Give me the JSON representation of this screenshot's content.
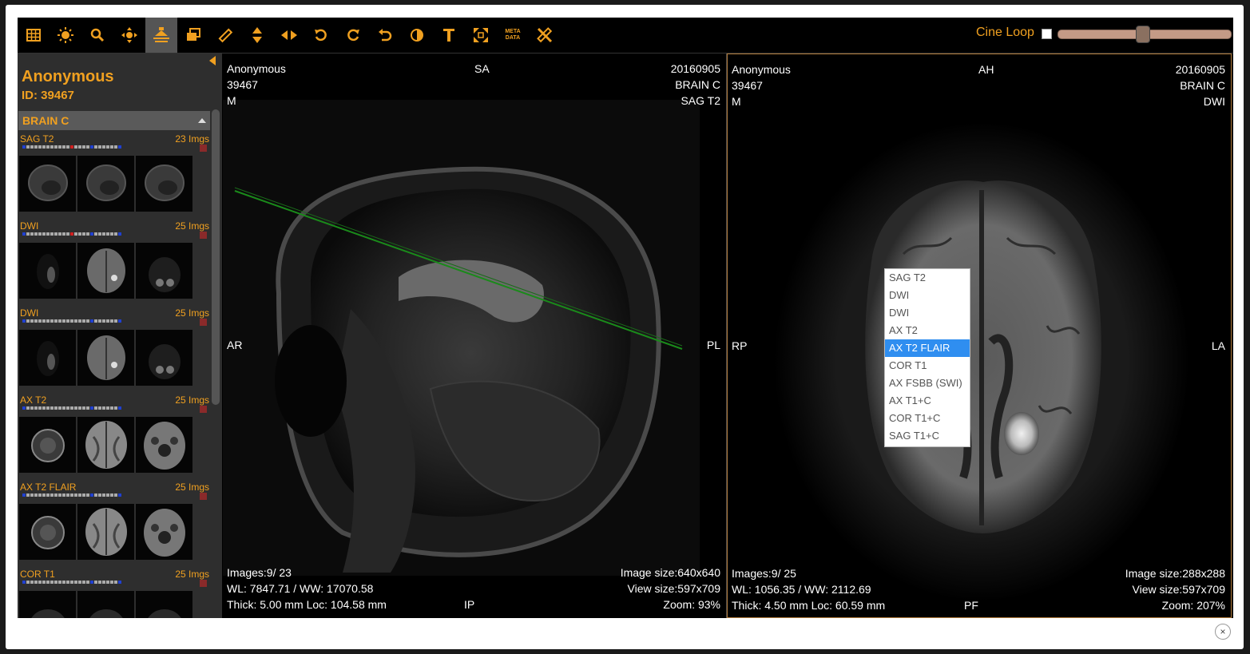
{
  "toolbar": {
    "cine_label": "Cine Loop",
    "meta_line1": "META",
    "meta_line2": "DATA",
    "accent": "#f0a020"
  },
  "patient": {
    "name": "Anonymous",
    "id": "ID: 39467"
  },
  "study": {
    "title": "BRAIN C"
  },
  "series": [
    {
      "name": "SAG T2",
      "count": "23 Imgs"
    },
    {
      "name": "DWI",
      "count": "25 Imgs"
    },
    {
      "name": "DWI",
      "count": "25 Imgs"
    },
    {
      "name": "AX T2",
      "count": "25 Imgs"
    },
    {
      "name": "AX T2 FLAIR",
      "count": "25 Imgs"
    },
    {
      "name": "COR T1",
      "count": "25 Imgs"
    }
  ],
  "viewports": {
    "left": {
      "name": "Anonymous",
      "id": "39467",
      "sex": "M",
      "top_orient": "SA",
      "date": "20160905",
      "study": "BRAIN C",
      "series": "SAG T2",
      "left_orient": "AR",
      "right_orient": "PL",
      "bottom_orient": "IP",
      "images": "Images:9/ 23",
      "wlww": "WL: 7847.71 / WW: 17070.58",
      "thick": "Thick: 5.00 mm Loc: 104.58 mm",
      "image_size": "Image size:640x640",
      "view_size": "View size:597x709",
      "zoom": "Zoom: 93%"
    },
    "right": {
      "name": "Anonymous",
      "id": "39467",
      "sex": "M",
      "top_orient": "AH",
      "date": "20160905",
      "study": "BRAIN C",
      "series": "DWI",
      "left_orient": "RP",
      "right_orient": "LA",
      "bottom_orient": "PF",
      "images": "Images:9/ 25",
      "wlww": "WL: 1056.35 / WW: 2112.69",
      "thick": "Thick: 4.50 mm Loc: 60.59 mm",
      "image_size": "Image size:288x288",
      "view_size": "View size:597x709",
      "zoom": "Zoom: 207%"
    }
  },
  "dropdown": {
    "options": [
      "SAG T2",
      "DWI",
      "DWI",
      "AX T2",
      "AX T2 FLAIR",
      "COR T1",
      "AX FSBB (SWI)",
      "AX T1+C",
      "COR T1+C",
      "SAG T1+C"
    ],
    "selected": "AX T2 FLAIR"
  },
  "close": "×"
}
